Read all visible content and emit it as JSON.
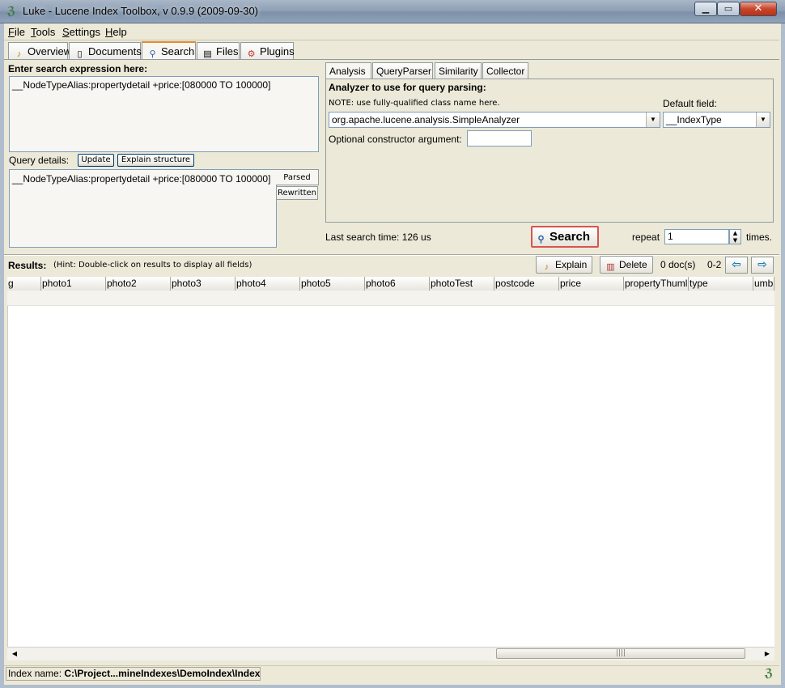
{
  "window": {
    "title": "Luke - Lucene Index Toolbox, v 0.9.9 (2009-09-30)"
  },
  "menu": [
    {
      "label": "File",
      "key": "F",
      "rest": "ile"
    },
    {
      "label": "Tools",
      "key": "T",
      "rest": "ools"
    },
    {
      "label": "Settings",
      "key": "S",
      "rest": "ettings"
    },
    {
      "label": "Help",
      "key": "H",
      "rest": "elp"
    }
  ],
  "tabs": [
    "Overview",
    "Documents",
    "Search",
    "Files",
    "Plugins"
  ],
  "search": {
    "expression_label": "Enter search expression here:",
    "expression": "__NodeTypeAlias:propertydetail +price:[080000 TO 100000]",
    "query_details_label": "Query details:",
    "update_button": "Update",
    "explain_structure_button": "Explain structure",
    "details_text": "__NodeTypeAlias:propertydetail +price:[080000 TO 100000]",
    "parsed_tab": "Parsed",
    "rewritten_tab": "Rewritten",
    "last_search_time": "Last search time: 126 us",
    "search_button": "Search",
    "repeat_label": "repeat",
    "repeat_value": "1",
    "times_label": "times."
  },
  "analysis": {
    "tabs": [
      "Analysis",
      "QueryParser",
      "Similarity",
      "Collector"
    ],
    "analyzer_label": "Analyzer to use for query parsing:",
    "note": "NOTE: use fully-qualified class name here.",
    "analyzer_value": "org.apache.lucene.analysis.SimpleAnalyzer",
    "default_field_label": "Default field:",
    "default_field_value": "__IndexType",
    "constructor_label": "Optional constructor argument:",
    "constructor_value": ""
  },
  "results": {
    "label": "Results:",
    "hint": "(Hint: Double-click on results to display all fields)",
    "explain_button": "Explain",
    "delete_button": "Delete",
    "doc_count": "0 doc(s)",
    "range": "0-2",
    "columns": [
      "g",
      "photo1",
      "photo2",
      "photo3",
      "photo4",
      "photo5",
      "photo6",
      "photoTest",
      "postcode",
      "price",
      "propertyThuml",
      "type",
      "umbr"
    ]
  },
  "status": {
    "index_label": "Index name:",
    "index_value": "C:\\Project...mineIndexes\\DemoIndex\\Index"
  },
  "colors": {
    "active_tab_accent": "#e68b2c",
    "search_button_border": "#d9534f"
  }
}
